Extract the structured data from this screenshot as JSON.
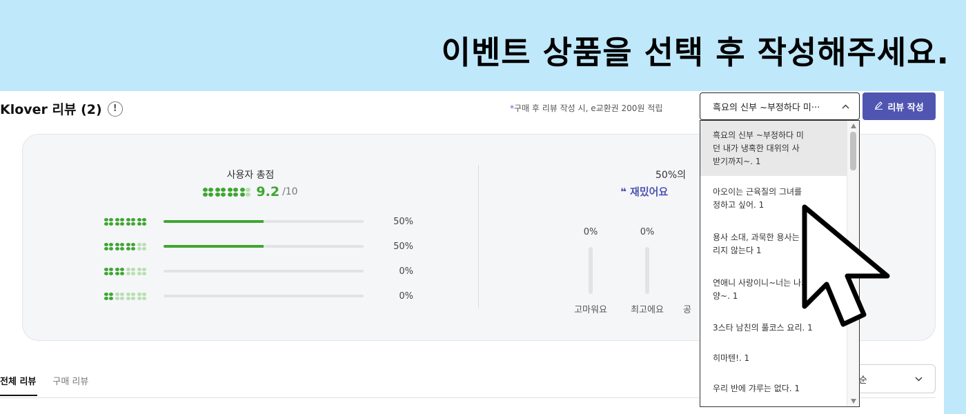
{
  "headline": "이벤트 상품을 선택 후 작성해주세요.",
  "review_header": {
    "title": "Klover 리뷰 (2)",
    "info_icon_glyph": "!",
    "note_star": "*",
    "note": "구매 후 리뷰 작성 시, e교환권 200원 적립",
    "selected_product": "흑요의 신부 ~부정하다 미···",
    "write_button": "리뷰 작성"
  },
  "user_score": {
    "label": "사용자 총점",
    "score": "9.2",
    "max": "/10",
    "distribution": [
      {
        "clovers": 4,
        "fraction": 0.5,
        "pct": "50%"
      },
      {
        "clovers": 3,
        "fraction": 0.5,
        "pct": "50%"
      },
      {
        "clovers": 2,
        "fraction": 0.0,
        "pct": "0%"
      },
      {
        "clovers": 1,
        "fraction": 0.0,
        "pct": "0%"
      }
    ]
  },
  "emotion": {
    "header": "50%의",
    "quote_mark": "❝",
    "quote": "재밌어요",
    "columns": [
      {
        "pct": "0%",
        "label": "고마워요"
      },
      {
        "pct": "0%",
        "label": "최고에요"
      },
      {
        "pct": "",
        "label": "공"
      }
    ]
  },
  "tabs": {
    "all": "전체 리뷰",
    "purchase": "구매 리뷰"
  },
  "sort": {
    "value": "최신순",
    "caret": "⌄"
  },
  "dropdown": {
    "items": [
      [
        "흑요의 신부 ~부정하다 미",
        "던 내가 냉혹한 대위의 사",
        "받기까지~. 1"
      ],
      [
        "아오이는 근육질의 그녀를",
        "정하고 싶어. 1"
      ],
      [
        "용사 소대, 과묵한 용사는 힘쓸",
        "리지 않는다 1"
      ],
      [
        "연애니 사랑이니~너는 나의 태",
        "양~. 1"
      ],
      [
        "3스타 남친의 풀코스 요리. 1"
      ],
      [
        "히마텐!. 1"
      ],
      [
        "우리 반에 갸루는 없다. 1"
      ]
    ]
  },
  "icons": {
    "caret_up": "chevron-up-icon",
    "pen": "pen-icon",
    "cursor": "mouse-pointer-icon"
  },
  "colors": {
    "accent": "#5055b1",
    "green": "#3fa631",
    "background": "#bfe8fb"
  }
}
